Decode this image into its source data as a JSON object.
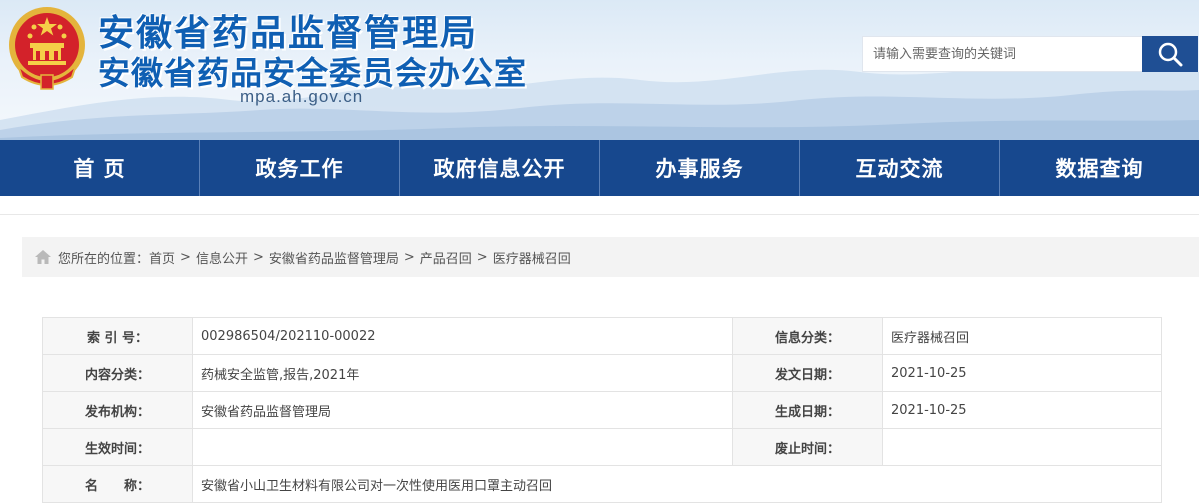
{
  "header": {
    "title_line1": "安徽省药品监督管理局",
    "title_line2": "安徽省药品安全委员会办公室",
    "domain": "mpa.ah.gov.cn",
    "emblem_icon": "national-emblem",
    "colors": {
      "title": "#0f5fb3",
      "nav": "#17488e",
      "search_btn": "#1f4f94"
    }
  },
  "search": {
    "placeholder": "请输入需要查询的关键词",
    "button_icon": "search-icon"
  },
  "nav": {
    "items": [
      "首 页",
      "政务工作",
      "政府信息公开",
      "办事服务",
      "互动交流",
      "数据查询"
    ]
  },
  "breadcrumb": {
    "icon": "home-icon",
    "prefix": "您所在的位置：",
    "items": [
      "首页",
      "信息公开",
      "安徽省药品监督管理局",
      "产品召回",
      "医疗器械召回"
    ],
    "separator": ">"
  },
  "meta": {
    "index_label": "索 引 号：",
    "index_value": "002986504/202110-00022",
    "category_label": "信息分类：",
    "category_value": "医疗器械召回",
    "content_label": "内容分类：",
    "content_value": "药械安全监管,报告,2021年",
    "issue_date_label": "发文日期：",
    "issue_date_value": "2021-10-25",
    "publisher_label": "发布机构：",
    "publisher_value": "安徽省药品监督管理局",
    "gen_date_label": "生成日期：",
    "gen_date_value": "2021-10-25",
    "effective_label": "生效时间：",
    "effective_value": "",
    "expire_label": "废止时间：",
    "expire_value": "",
    "name_label": "名　　称：",
    "name_value": "安徽省小山卫生材料有限公司对一次性使用医用口罩主动召回"
  }
}
